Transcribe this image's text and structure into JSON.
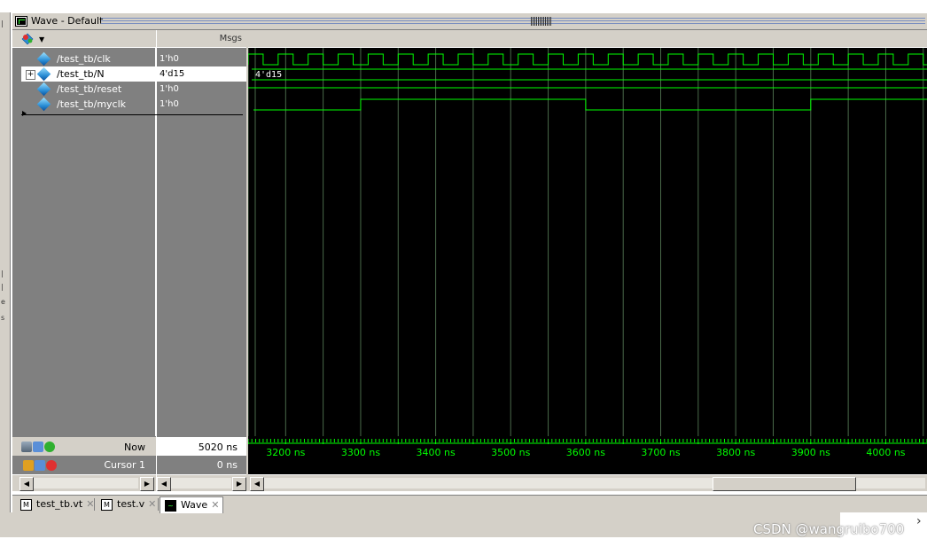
{
  "window": {
    "title": "Wave - Default"
  },
  "columns": {
    "msgs_label": "Msgs"
  },
  "signals": [
    {
      "name": "/test_tb/clk",
      "value": "1'h0"
    },
    {
      "name": "/test_tb/N",
      "value": "4'd15",
      "expandable": true,
      "selected": true
    },
    {
      "name": "/test_tb/reset",
      "value": "1'h0"
    },
    {
      "name": "/test_tb/myclk",
      "value": "1'h0"
    }
  ],
  "bus_label": "4'd15",
  "time_pane": {
    "now_label": "Now",
    "now_value": "5020 ns",
    "cursor_label": "Cursor 1",
    "cursor_value": "0 ns",
    "ruler_labels": [
      "3200 ns",
      "3300 ns",
      "3400 ns",
      "3500 ns",
      "3600 ns",
      "3700 ns",
      "3800 ns",
      "3900 ns",
      "4000 ns"
    ]
  },
  "waveforms": {
    "time_start_ns": 3150,
    "time_end_ns": 4055,
    "clk_period_ns": 40,
    "clk_first_rise_ns": 3170,
    "myclk_edges_ns": [
      3300,
      3600,
      3900
    ],
    "myclk_initial": 0
  },
  "tabs": [
    {
      "label": "test_tb.vt",
      "icon": "M",
      "active": false
    },
    {
      "label": "test.v",
      "icon": "M",
      "active": false
    },
    {
      "label": "Wave",
      "icon": "wave",
      "active": true
    }
  ],
  "watermark": "CSDN @wangruibo700",
  "colors": {
    "wave": "#00ff00",
    "grid": "#4a6a4a",
    "pane_gray": "#808080",
    "chrome": "#d4d0c8"
  }
}
